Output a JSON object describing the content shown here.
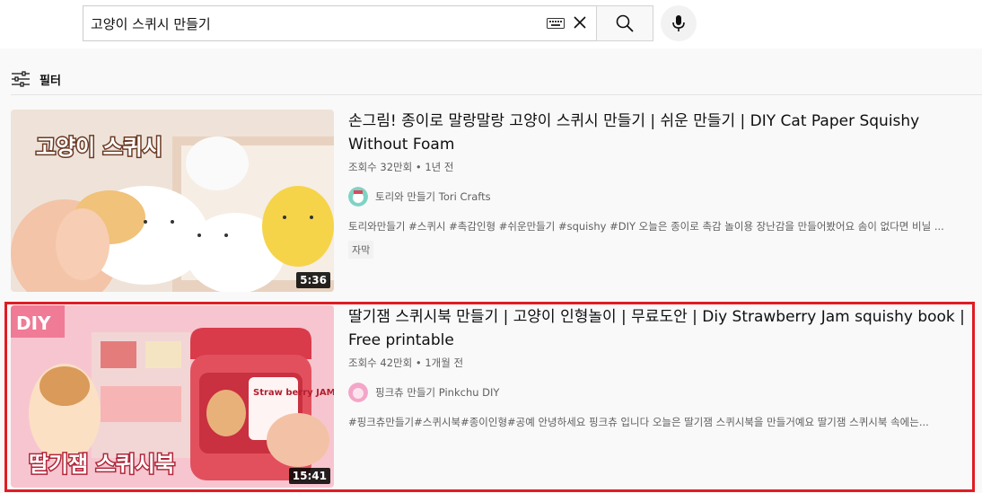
{
  "search": {
    "query": "고양이 스퀴시 만들기"
  },
  "filter": {
    "label": "필터"
  },
  "results": [
    {
      "title": "손그림! 종이로 말랑말랑 고양이 스퀴시 만들기 | 쉬운 만들기 | DIY Cat Paper Squishy Without Foam",
      "views": "조회수 32만회",
      "age": "1년 전",
      "channel": "토리와 만들기 Tori Crafts",
      "description": "토리와만들기 #스퀴시 #촉감인형 #쉬운만들기 #squishy #DIY 오늘은 종이로 촉감 놀이용 장난감을 만들어봤어요 솜이 없다면 비닐 ...",
      "badge": "자막",
      "duration": "5:36",
      "thumb_text": "고양이 스퀴시"
    },
    {
      "title": "딸기잼 스퀴시북 만들기 | 고양이 인형놀이 | 무료도안 | Diy Strawberry Jam squishy book | Free printable",
      "views": "조회수 42만회",
      "age": "1개월 전",
      "channel": "핑크츄 만들기 Pinkchu DIY",
      "description": "#핑크츄만들기#스퀴시북#종이인형#공예 안녕하세요 핑크츄 입니다 오늘은 딸기잼 스퀴시북을 만들거예요 딸기잼 스퀴시북 속에는...",
      "duration": "15:41",
      "thumb_text": "딸기잼 스퀴시북",
      "thumb_tag": "DIY",
      "jar_label": "Straw berry JAM"
    }
  ],
  "colors": {
    "highlight": "#e01c24",
    "meta_text": "#606060"
  }
}
